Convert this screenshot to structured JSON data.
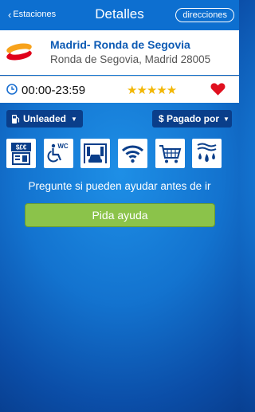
{
  "nav": {
    "back_label": "Estaciones",
    "title": "Detalles",
    "directions_label": "direcciones"
  },
  "station": {
    "name": "Madrid- Ronda de Segovia",
    "address": "Ronda de Segovia, Madrid 28005",
    "hours": "00:00-23:59",
    "rating": "★★★★★",
    "rating_value": 5,
    "favorite": true
  },
  "filters": {
    "fuel_label": "Unleaded",
    "payment_label": "$ Pagado por"
  },
  "amenities": [
    {
      "icon": "atm-icon"
    },
    {
      "icon": "accessible-wc-icon"
    },
    {
      "icon": "car-wash-icon"
    },
    {
      "icon": "wifi-icon"
    },
    {
      "icon": "shopping-cart-icon"
    },
    {
      "icon": "water-icon"
    }
  ],
  "notice": "Pregunte si pueden ayudar antes de ir",
  "help_button_label": "Pida ayuda",
  "colors": {
    "nav_blue": "#0d6fd0",
    "accent_navy": "#0a3e8a",
    "help_green": "#8bc34a",
    "star_gold": "#f2b705",
    "heart_red": "#e0101f",
    "brand_red": "#e0001b",
    "brand_orange": "#f7a21b"
  }
}
